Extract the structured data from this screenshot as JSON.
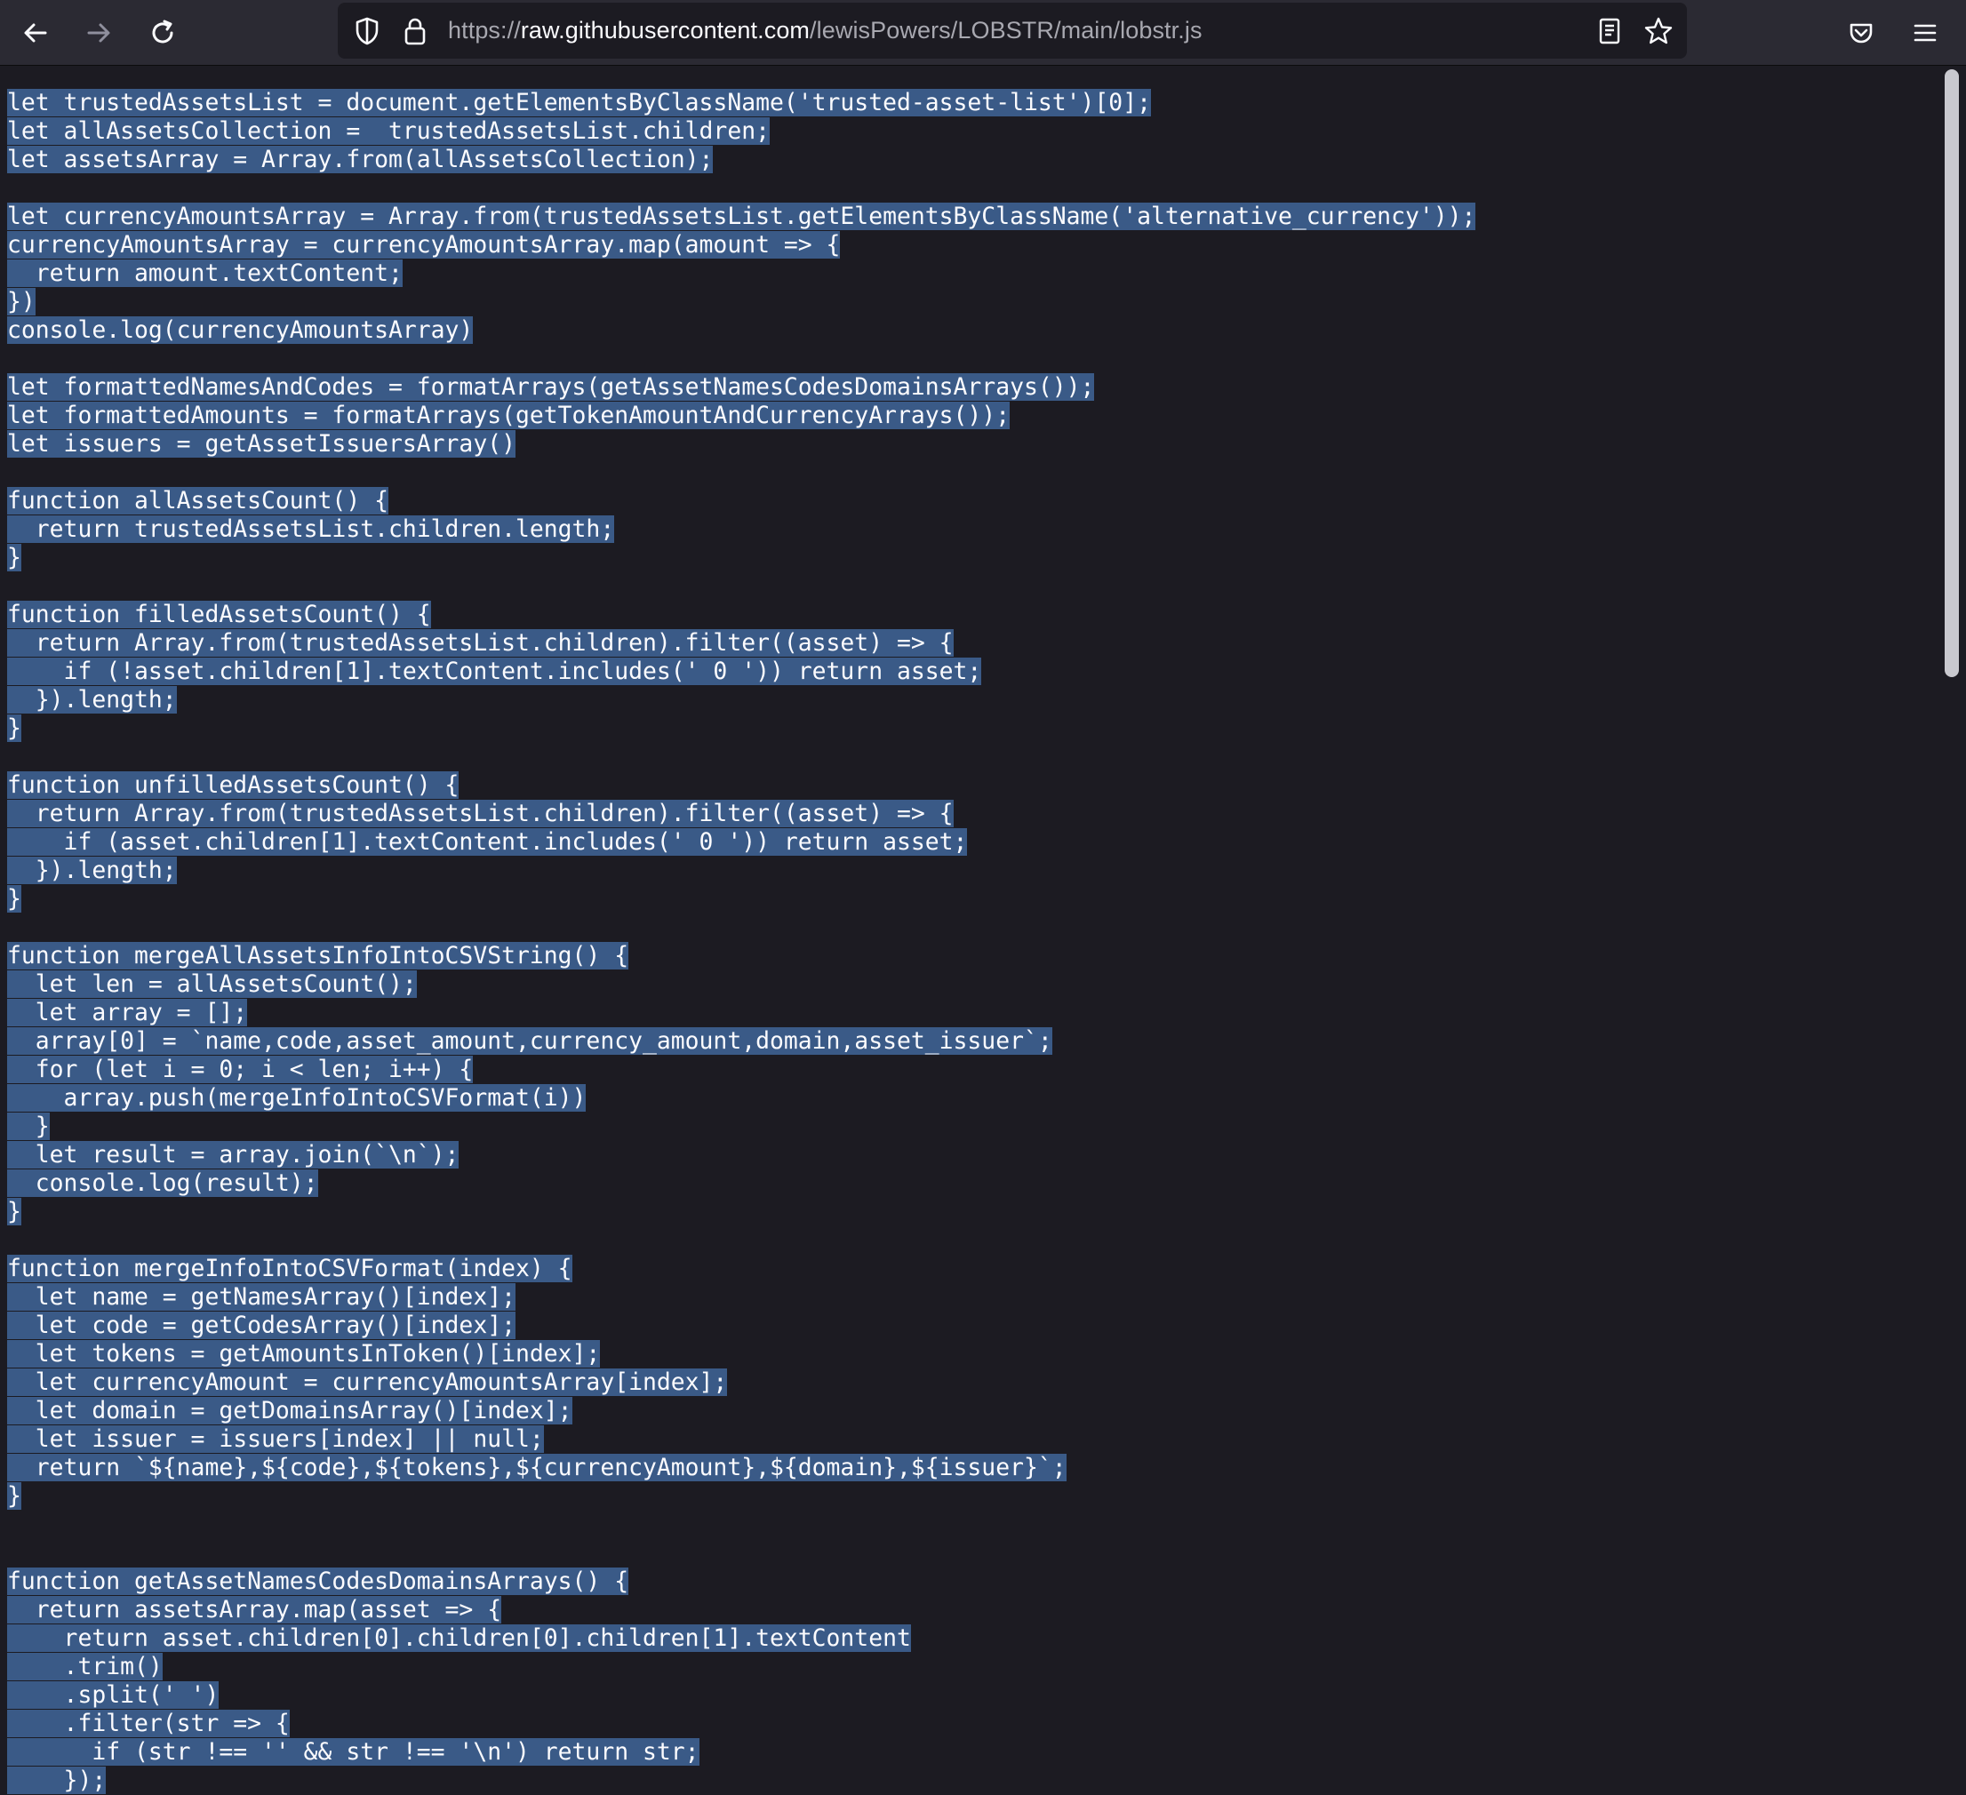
{
  "browser": {
    "url_scheme": "https://",
    "url_host": "raw.githubusercontent.com",
    "url_path": "/lewisPowers/LOBSTR/main/lobstr.js",
    "nav": {
      "back": "back-arrow-icon",
      "forward": "forward-arrow-icon",
      "reload": "reload-icon"
    },
    "url_icons": [
      "shield-icon",
      "lock-icon",
      "reader-view-icon",
      "star-bookmark-icon"
    ],
    "right_icons": [
      "pocket-icon",
      "menu-icon"
    ]
  },
  "code_lines": [
    "let trustedAssetsList = document.getElementsByClassName('trusted-asset-list')[0];",
    "let allAssetsCollection =  trustedAssetsList.children;",
    "let assetsArray = Array.from(allAssetsCollection);",
    "",
    "let currencyAmountsArray = Array.from(trustedAssetsList.getElementsByClassName('alternative_currency'));",
    "currencyAmountsArray = currencyAmountsArray.map(amount => {",
    "  return amount.textContent;",
    "})",
    "console.log(currencyAmountsArray)",
    "",
    "let formattedNamesAndCodes = formatArrays(getAssetNamesCodesDomainsArrays());",
    "let formattedAmounts = formatArrays(getTokenAmountAndCurrencyArrays());",
    "let issuers = getAssetIssuersArray()",
    "",
    "function allAssetsCount() {",
    "  return trustedAssetsList.children.length;",
    "}",
    "",
    "function filledAssetsCount() {",
    "  return Array.from(trustedAssetsList.children).filter((asset) => {",
    "    if (!asset.children[1].textContent.includes(' 0 ')) return asset;",
    "  }).length;",
    "}",
    "",
    "function unfilledAssetsCount() {",
    "  return Array.from(trustedAssetsList.children).filter((asset) => {",
    "    if (asset.children[1].textContent.includes(' 0 ')) return asset;",
    "  }).length;",
    "}",
    "",
    "function mergeAllAssetsInfoIntoCSVString() {",
    "  let len = allAssetsCount();",
    "  let array = [];",
    "  array[0] = `name,code,asset_amount,currency_amount,domain,asset_issuer`;",
    "  for (let i = 0; i < len; i++) {",
    "    array.push(mergeInfoIntoCSVFormat(i))",
    "  }",
    "  let result = array.join(`\\n`);",
    "  console.log(result);",
    "}",
    "",
    "function mergeInfoIntoCSVFormat(index) {",
    "  let name = getNamesArray()[index];",
    "  let code = getCodesArray()[index];",
    "  let tokens = getAmountsInToken()[index];",
    "  let currencyAmount = currencyAmountsArray[index];",
    "  let domain = getDomainsArray()[index];",
    "  let issuer = issuers[index] || null;",
    "  return `${name},${code},${tokens},${currencyAmount},${domain},${issuer}`;",
    "}",
    "",
    "",
    "function getAssetNamesCodesDomainsArrays() {",
    "  return assetsArray.map(asset => {",
    "    return asset.children[0].children[0].children[1].textContent",
    "    .trim()",
    "    .split(' ')",
    "    .filter(str => {",
    "      if (str !== '' && str !== '\\n') return str;",
    "    });"
  ]
}
